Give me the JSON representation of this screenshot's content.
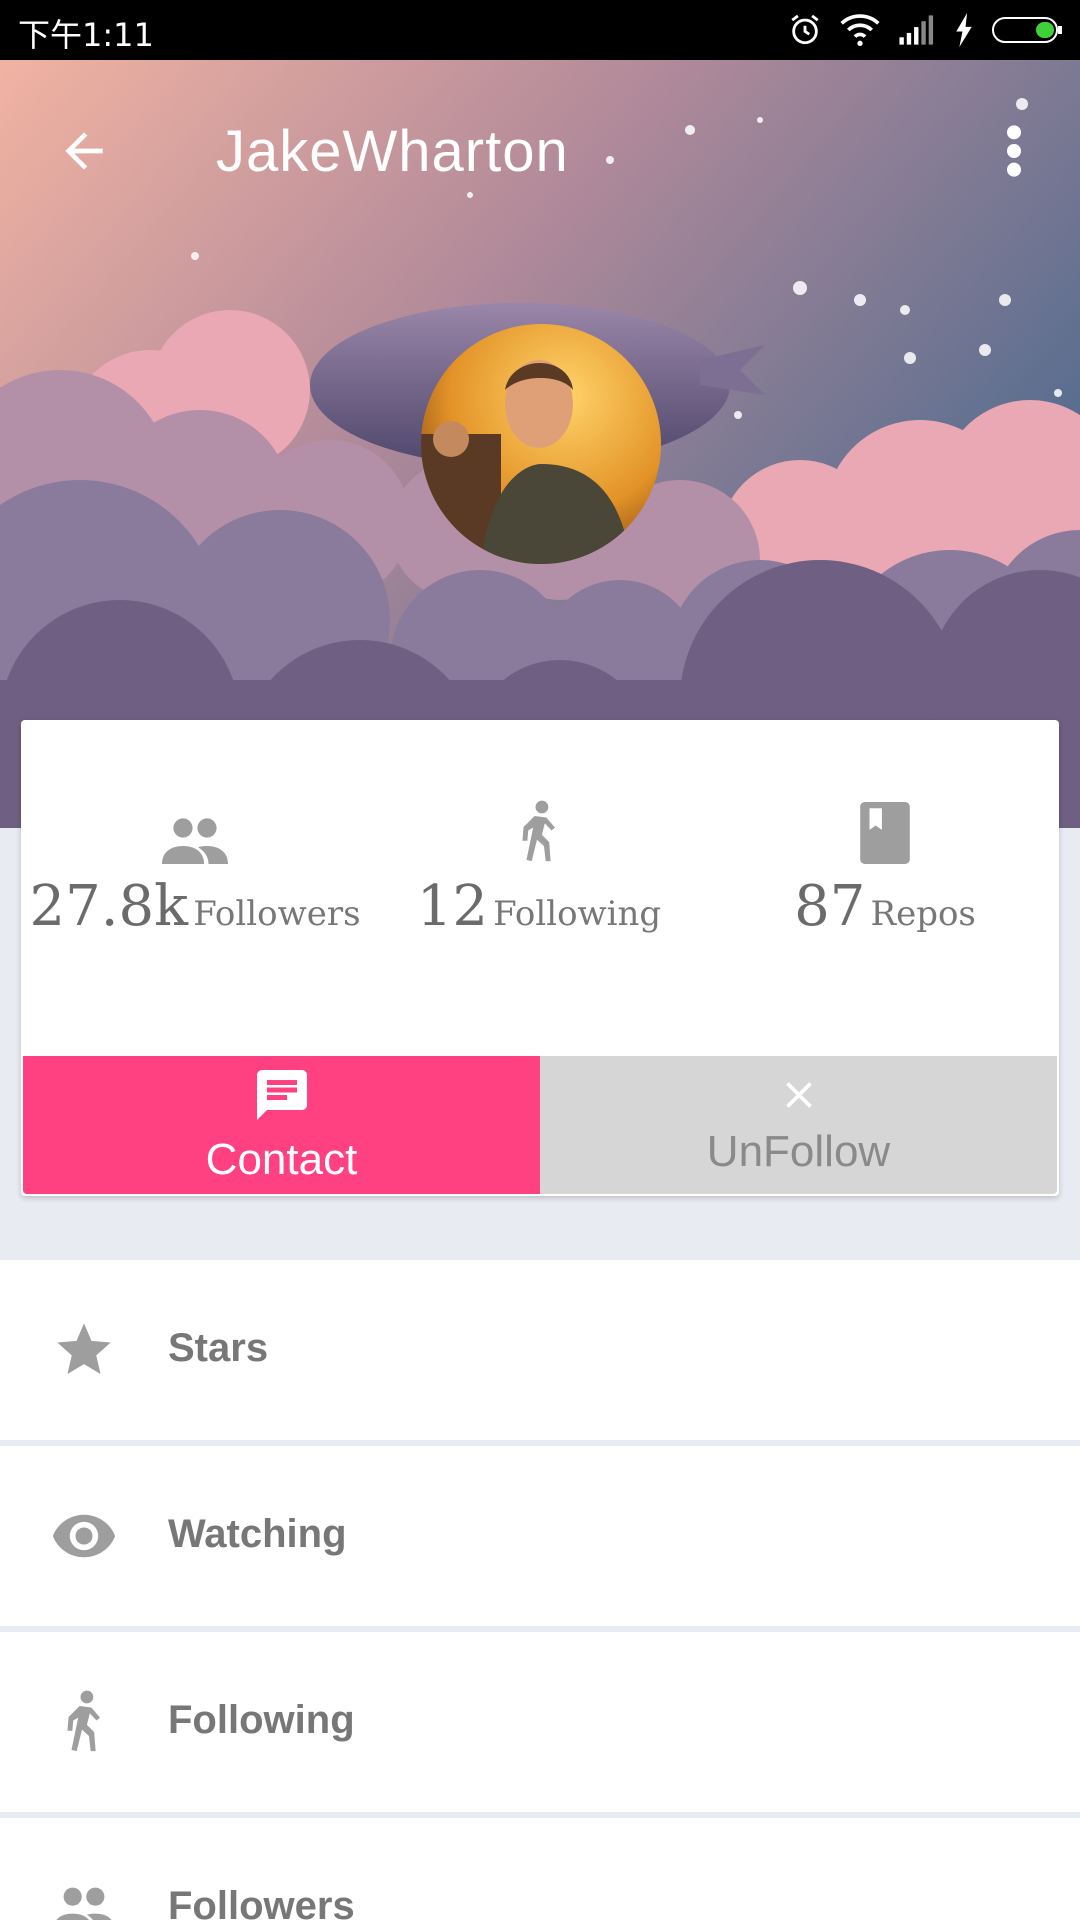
{
  "status_bar": {
    "time": "下午1:11",
    "icons": [
      "alarm-icon",
      "wifi-icon",
      "signal-icon",
      "charging-icon",
      "battery-icon"
    ]
  },
  "toolbar": {
    "title": "JakeWharton",
    "back_icon": "arrow-back-icon",
    "more_icon": "more-vert-icon"
  },
  "stats": {
    "followers": {
      "value": "27.8k",
      "label": "Followers",
      "icon": "people-icon"
    },
    "following": {
      "value": "12",
      "label": "Following",
      "icon": "walk-icon"
    },
    "repos": {
      "value": "87",
      "label": "Repos",
      "icon": "book-icon"
    }
  },
  "actions": {
    "contact": {
      "label": "Contact",
      "icon": "message-icon"
    },
    "unfollow": {
      "label": "UnFollow",
      "icon": "close-icon"
    }
  },
  "list": {
    "items": [
      {
        "label": "Stars",
        "icon": "star-icon"
      },
      {
        "label": "Watching",
        "icon": "eye-icon"
      },
      {
        "label": "Following",
        "icon": "walk-icon"
      },
      {
        "label": "Followers",
        "icon": "people-icon"
      }
    ]
  },
  "colors": {
    "accent": "#ff4081",
    "unfollow_bg": "#d6d6d6",
    "page_bg": "#e9ebf3",
    "icon_gray": "#9e9e9e"
  }
}
